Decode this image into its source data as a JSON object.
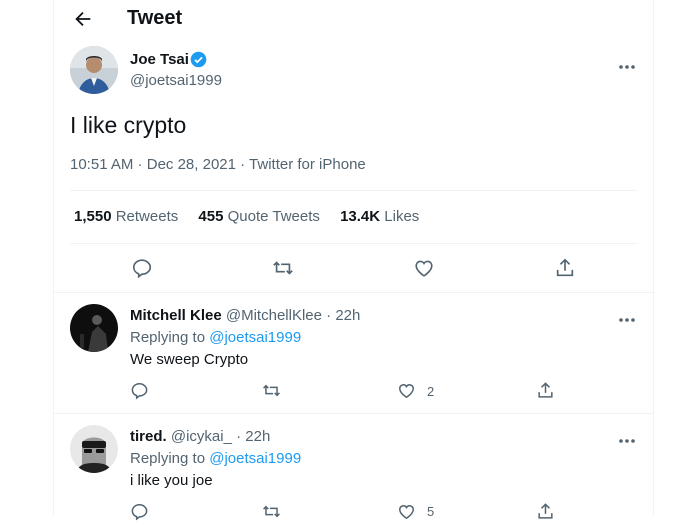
{
  "header": {
    "title": "Tweet"
  },
  "tweet": {
    "author_name": "Joe Tsai",
    "author_handle": "@joetsai1999",
    "text": "I like crypto",
    "time": "10:51 AM",
    "date": "Dec 28, 2021",
    "source": "Twitter for iPhone",
    "sep": " · ",
    "stats": {
      "retweets_count": "1,550",
      "retweets_label": "Retweets",
      "quotes_count": "455",
      "quotes_label": "Quote Tweets",
      "likes_count": "13.4K",
      "likes_label": "Likes"
    }
  },
  "replies": [
    {
      "name": "Mitchell Klee",
      "handle": "@MitchellKlee",
      "time": "22h",
      "replying_label": "Replying to",
      "replying_to": "@joetsai1999",
      "text": "We sweep Crypto",
      "like_count": "2"
    },
    {
      "name": "tired.",
      "handle": "@icykai_",
      "time": "22h",
      "replying_label": "Replying to",
      "replying_to": "@joetsai1999",
      "text": "i like you joe",
      "like_count": "5"
    }
  ],
  "icons": [
    "back-arrow-icon",
    "verified-badge-icon",
    "more-icon",
    "reply-icon",
    "retweet-icon",
    "like-icon",
    "share-icon"
  ],
  "colors": {
    "accent": "#1d9bf0",
    "secondary_text": "#536471",
    "divider": "#eff3f4"
  }
}
